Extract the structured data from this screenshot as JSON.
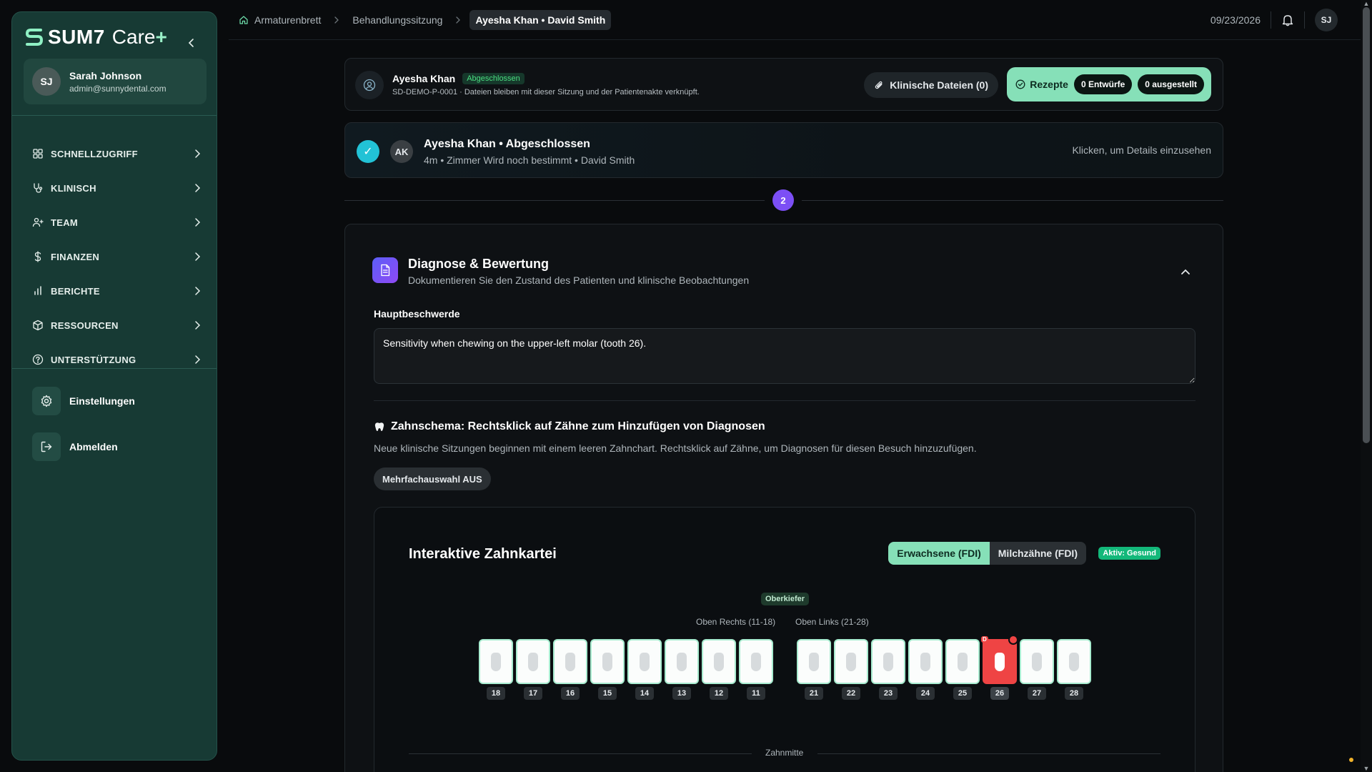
{
  "brand": {
    "name": "SUM7",
    "suffix_text": "Care",
    "suffix_plus": "+"
  },
  "user": {
    "initials": "SJ",
    "name": "Sarah Johnson",
    "email": "admin@sunnydental.com"
  },
  "nav": {
    "items": [
      {
        "label": "SCHNELLZUGRIFF",
        "icon": "grid-icon"
      },
      {
        "label": "KLINISCH",
        "icon": "stethoscope-icon"
      },
      {
        "label": "TEAM",
        "icon": "users-icon"
      },
      {
        "label": "FINANZEN",
        "icon": "dollar-icon"
      },
      {
        "label": "BERICHTE",
        "icon": "bar-chart-icon"
      },
      {
        "label": "RESSOURCEN",
        "icon": "package-icon"
      },
      {
        "label": "UNTERSTÜTZUNG",
        "icon": "help-circle-icon"
      }
    ],
    "settings_label": "Einstellungen",
    "logout_label": "Abmelden"
  },
  "breadcrumb": {
    "home": "Armaturenbrett",
    "section": "Behandlungssitzung",
    "current": "Ayesha Khan • David Smith"
  },
  "topbar": {
    "date": "09/23/2026",
    "avatar_initials": "SJ"
  },
  "patient_header": {
    "name": "Ayesha Khan",
    "status": "Abgeschlossen",
    "meta": "SD-DEMO-P-0001 · Dateien bleiben mit dieser Sitzung und der Patientenakte verknüpft.",
    "files_button": "Klinische Dateien (0)",
    "rx_label": "Rezepte",
    "rx_drafts": "0 Entwürfe",
    "rx_issued": "0 ausgestellt"
  },
  "session": {
    "initials": "AK",
    "title": "Ayesha Khan • Abgeschlossen",
    "meta": "4m • Zimmer Wird noch bestimmt • David Smith",
    "details_link": "Klicken, um Details einzusehen"
  },
  "step": {
    "number": "2"
  },
  "diagnosis": {
    "title": "Diagnose & Bewertung",
    "subtitle": "Dokumentieren Sie den Zustand des Patienten und klinische Beobachtungen",
    "complaint_label": "Hauptbeschwerde",
    "complaint_value": "Sensitivity when chewing on the upper-left molar (tooth 26).",
    "chart_heading": "Zahnschema: Rechtsklick auf Zähne zum Hinzufügen von Diagnosen",
    "chart_description": "Neue klinische Sitzungen beginnen mit einem leeren Zahnchart. Rechtsklick auf Zähne, um Diagnosen für diesen Besuch hinzuzufügen.",
    "multiselect_label": "Mehrfachauswahl AUS"
  },
  "tooth_chart": {
    "title": "Interaktive Zahnkartei",
    "mode_adult": "Erwachsene (FDI)",
    "mode_child": "Milchzähne (FDI)",
    "active_mode": "adult",
    "active_badge": "Aktiv: Gesund",
    "jaw_label": "Oberkiefer",
    "upper_right_label": "Oben Rechts (11-18)",
    "upper_left_label": "Oben Links (21-28)",
    "upper_right_teeth": [
      "18",
      "17",
      "16",
      "15",
      "14",
      "13",
      "12",
      "11"
    ],
    "upper_left_teeth": [
      "21",
      "22",
      "23",
      "24",
      "25",
      "26",
      "27",
      "28"
    ],
    "diagnosed_tooth": "26",
    "diagnosis_marker": "D",
    "midline_label": "Zahnmitte"
  },
  "colors": {
    "sidebar_bg": "#173a34",
    "accent_mint": "#86e0b8",
    "diagnosis_red": "#ef4444",
    "step_purple": "#7c4ff5",
    "session_check": "#22c2d6",
    "status_green": "#4ade80"
  }
}
